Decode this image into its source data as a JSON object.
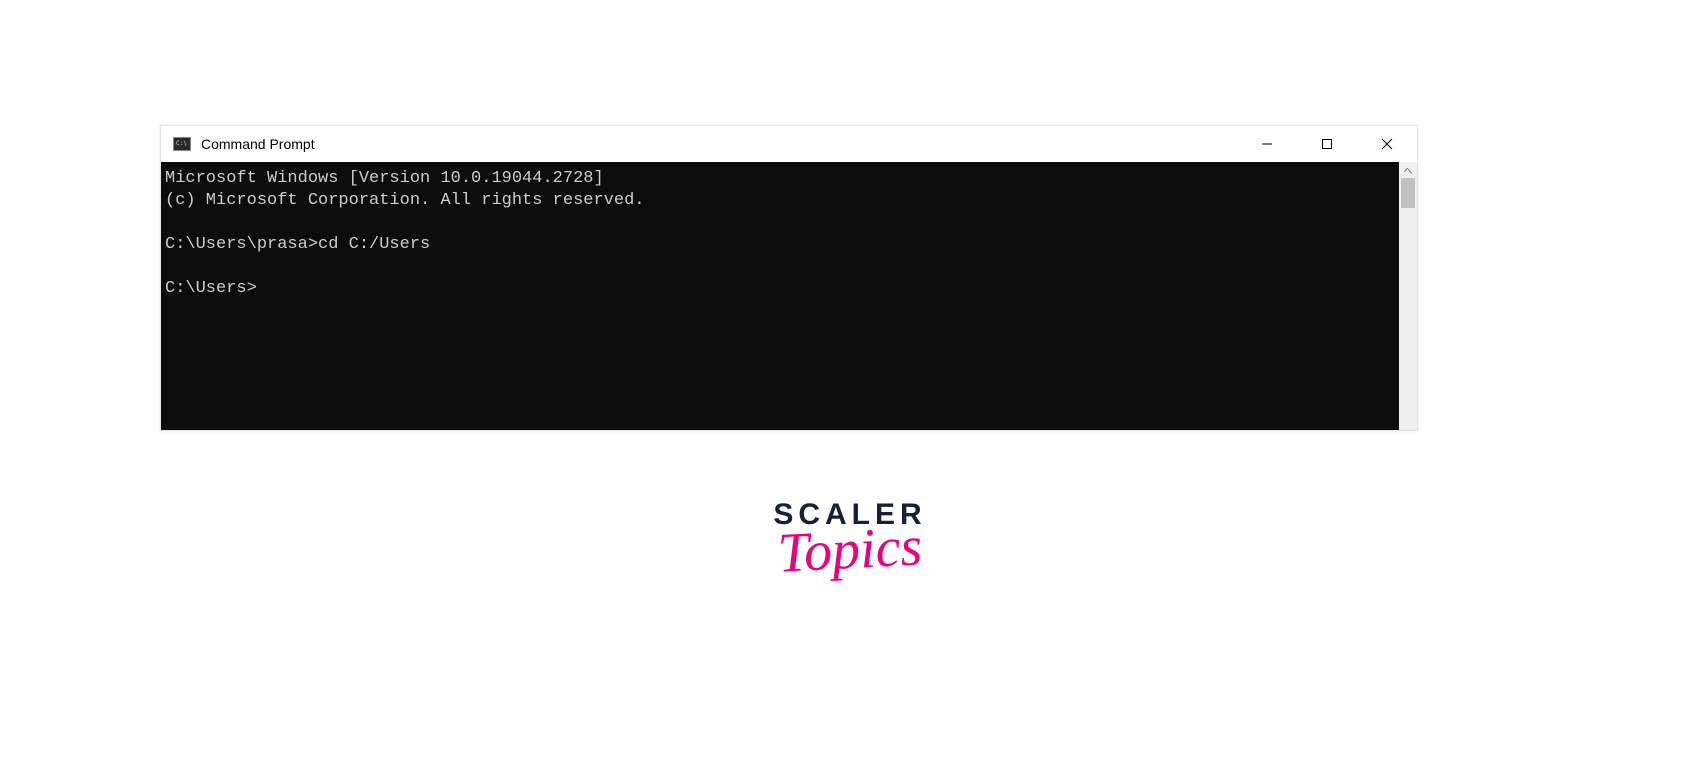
{
  "window": {
    "title": "Command Prompt"
  },
  "terminal": {
    "line1": "Microsoft Windows [Version 10.0.19044.2728]",
    "line2": "(c) Microsoft Corporation. All rights reserved.",
    "blank1": "",
    "prompt1": "C:\\Users\\prasa>cd C:/Users",
    "blank2": "",
    "prompt2": "C:\\Users>"
  },
  "logo": {
    "line1": "SCALER",
    "line2": "Topics"
  }
}
